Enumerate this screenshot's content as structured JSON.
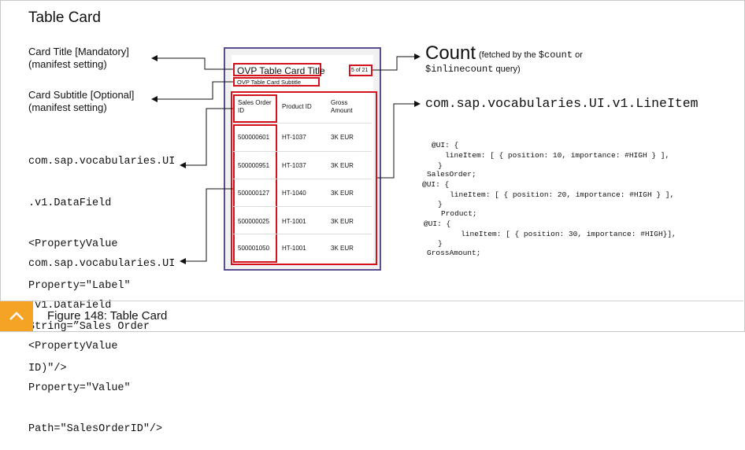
{
  "page": {
    "title": "Table Card"
  },
  "left_labels": {
    "card_title": [
      "Card Title  [Mandatory]",
      "(manifest setting)"
    ],
    "card_subtitle": [
      "Card Subtitle  [Optional]",
      "(manifest setting)"
    ],
    "datafield_label": [
      "com.sap.vocabularies.UI",
      ".v1.DataField",
      "<PropertyValue",
      "Property=\"Label\"",
      "String=”Sales Order",
      "ID)\"/>"
    ],
    "datafield_value": [
      "com.sap.vocabularies.UI",
      ".v1.DataField",
      "<PropertyValue",
      "Property=\"Value\"",
      "Path=\"SalesOrderID\"/>"
    ]
  },
  "card": {
    "title": "OVP Table Card Title",
    "subtitle": "OVP Table Card Subtitle",
    "count": "5 of 21",
    "columns": [
      "Sales Order ID",
      "Product ID",
      "Gross Amount"
    ],
    "rows": [
      [
        "500000601",
        "HT-1037",
        "3K EUR"
      ],
      [
        "500000951",
        "HT-1037",
        "3K EUR"
      ],
      [
        "500000127",
        "HT-1040",
        "3K EUR"
      ],
      [
        "500000025",
        "HT-1001",
        "3K EUR"
      ],
      [
        "500001050",
        "HT-1001",
        "3K EUR"
      ]
    ]
  },
  "right": {
    "count_title": "Count",
    "count_note_prefix": "(fetched by the ",
    "count_note_code1": "$count",
    "count_note_mid": " or",
    "count_note_code2": "$inlinecount",
    "count_note_suffix": " query)",
    "lineitem_heading": "com.sap.vocabularies.UI.v1.LineItem",
    "code_lines": [
      "@UI: {",
      "   lineItem: [ { position: 10, importance: #HIGH } ],",
      "}",
      "SalesOrder;",
      "@UI: {",
      "   lineItem: [ { position: 20, importance: #HIGH } ],",
      "}",
      "Product;",
      "@UI: {",
      "   lineItem: [ { position: 30, importance: #HIGH}],",
      "}",
      "GrossAmount;"
    ]
  },
  "footer": {
    "caption": "Figure 148: Table Card"
  },
  "colors": {
    "annotation_red": "#d4121c",
    "card_border": "#5a4e8e",
    "footer_accent": "#f5a325"
  }
}
